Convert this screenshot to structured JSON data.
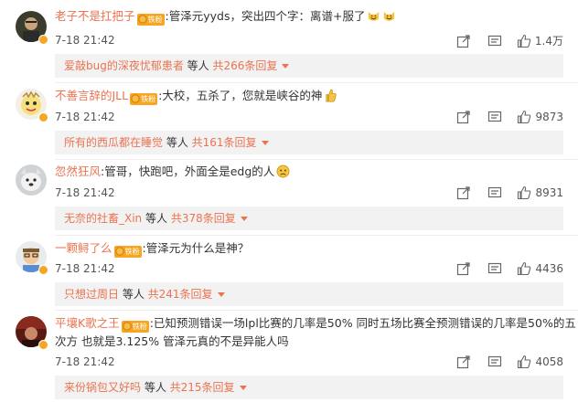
{
  "comments": [
    {
      "username": "老子不是扛把子",
      "fan_badge": "铁粉",
      "text": ":管泽元yyds，突出四个字：离谱+服了",
      "emojis": [
        "laughing-cat-emoji",
        "laughing-cat-emoji"
      ],
      "time": "7-18 21:42",
      "likes": "1.4万",
      "reply": {
        "name": "爱敲bug的深夜忧郁患者",
        "mid": " 等人 ",
        "count": "共266条回复"
      }
    },
    {
      "username": "不善言辞的JLL",
      "fan_badge": "铁粉",
      "text": ":大校，五杀了，您就是峡谷的神",
      "emojis": [
        "thumbs-up-emoji"
      ],
      "time": "7-18 21:42",
      "likes": "9873",
      "reply": {
        "name": "所有的西瓜都在睡觉",
        "mid": " 等人 ",
        "count": "共161条回复"
      }
    },
    {
      "username": "忽然狂风",
      "fan_badge": "",
      "text": ":管哥，快跑吧，外面全是edg的人",
      "emojis": [
        "worried-face-emoji"
      ],
      "time": "7-18 21:42",
      "likes": "8931",
      "reply": {
        "name": "无奈的社畜_Xin",
        "mid": " 等人 ",
        "count": "共378条回复"
      }
    },
    {
      "username": "一颗鲟了么",
      "fan_badge": "铁粉",
      "text": ":管泽元为什么是神？",
      "emojis": [],
      "time": "7-18 21:42",
      "likes": "4436",
      "reply": {
        "name": "只想过周日",
        "mid": " 等人 ",
        "count": "共241条回复"
      }
    },
    {
      "username": "平壤K歌之王",
      "fan_badge": "铁粉",
      "text": ":已知预测错误一场lpl比赛的几率是50% 同时五场比赛全预测错误的几率是50%的五",
      "text2": "次方 也就是3.125% 管泽元真的不是异能人吗",
      "emojis": [],
      "time": "7-18 21:42",
      "likes": "4058",
      "reply": {
        "name": "来份锅包又好吗",
        "mid": " 等人 ",
        "count": "共215条回复"
      }
    }
  ],
  "colors": {
    "username": "#eb7350",
    "badge": "#f6a623",
    "reply_bg": "#f2f2f2"
  }
}
